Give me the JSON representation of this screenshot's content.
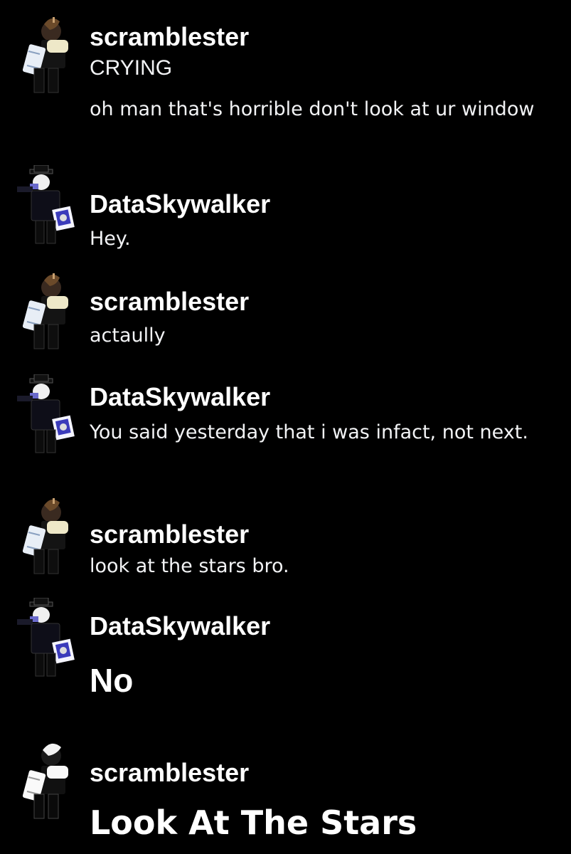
{
  "messages": [
    {
      "username": "scramblester",
      "avatar_icon": "roblox-avatar-scramblester-icon",
      "lines": [
        "CRYING",
        "oh man that's horrible don't look at ur window"
      ]
    },
    {
      "username": "DataSkywalker",
      "avatar_icon": "roblox-avatar-dataskywalker-icon",
      "lines": [
        "Hey."
      ]
    },
    {
      "username": "scramblester",
      "avatar_icon": "roblox-avatar-scramblester-icon",
      "lines": [
        "actaully"
      ]
    },
    {
      "username": "DataSkywalker",
      "avatar_icon": "roblox-avatar-dataskywalker-icon",
      "lines": [
        "You said yesterday that i was infact, not next."
      ]
    },
    {
      "username": "scramblester",
      "avatar_icon": "roblox-avatar-scramblester-icon",
      "lines": [
        "look at the stars bro."
      ]
    },
    {
      "username": "DataSkywalker",
      "avatar_icon": "roblox-avatar-dataskywalker-icon",
      "lines": [
        "No"
      ]
    },
    {
      "username": "scramblester",
      "avatar_icon": "roblox-avatar-scramblester-icon",
      "lines": [
        "Look At The Stars"
      ]
    }
  ],
  "colors": {
    "background": "#000000",
    "username": "#ffffff",
    "message_text": "#f2f3f5"
  }
}
